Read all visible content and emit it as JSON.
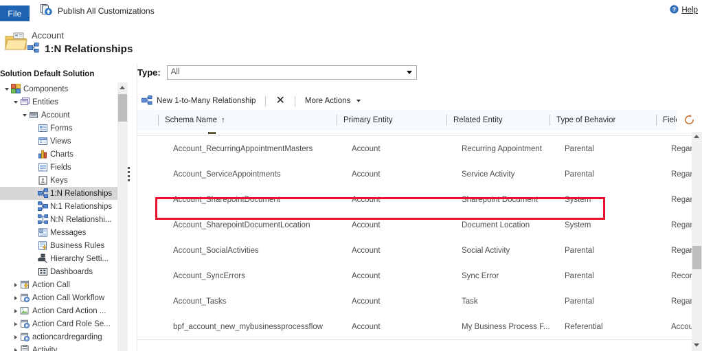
{
  "ribbon": {
    "file_tab": "File",
    "publish_label": "Publish All Customizations",
    "publish_icon": "publish-icon",
    "help_label": "Help",
    "help_icon": "help-icon"
  },
  "page_header": {
    "entity_name": "Account",
    "title": "1:N Relationships",
    "folder_icon": "folder-icon",
    "relationship_icon": "one-to-many-icon"
  },
  "solution": {
    "label": "Solution Default Solution"
  },
  "tree": {
    "items": [
      {
        "label": "Components",
        "depth": 0,
        "twisty": "open",
        "icon": "components-icon",
        "selected": false
      },
      {
        "label": "Entities",
        "depth": 1,
        "twisty": "open",
        "icon": "entities-icon",
        "selected": false
      },
      {
        "label": "Account",
        "depth": 2,
        "twisty": "open",
        "icon": "entity-icon",
        "selected": false
      },
      {
        "label": "Forms",
        "depth": 3,
        "twisty": "none",
        "icon": "forms-icon",
        "selected": false
      },
      {
        "label": "Views",
        "depth": 3,
        "twisty": "none",
        "icon": "views-icon",
        "selected": false
      },
      {
        "label": "Charts",
        "depth": 3,
        "twisty": "none",
        "icon": "charts-icon",
        "selected": false
      },
      {
        "label": "Fields",
        "depth": 3,
        "twisty": "none",
        "icon": "fields-icon",
        "selected": false
      },
      {
        "label": "Keys",
        "depth": 3,
        "twisty": "none",
        "icon": "keys-icon",
        "selected": false
      },
      {
        "label": "1:N Relationships",
        "depth": 3,
        "twisty": "none",
        "icon": "one-to-many-icon",
        "selected": true
      },
      {
        "label": "N:1 Relationships",
        "depth": 3,
        "twisty": "none",
        "icon": "many-to-one-icon",
        "selected": false
      },
      {
        "label": "N:N Relationshi...",
        "depth": 3,
        "twisty": "none",
        "icon": "many-to-many-icon",
        "selected": false
      },
      {
        "label": "Messages",
        "depth": 3,
        "twisty": "none",
        "icon": "messages-icon",
        "selected": false
      },
      {
        "label": "Business Rules",
        "depth": 3,
        "twisty": "none",
        "icon": "business-rules-icon",
        "selected": false
      },
      {
        "label": "Hierarchy Setti...",
        "depth": 3,
        "twisty": "none",
        "icon": "hierarchy-icon",
        "selected": false
      },
      {
        "label": "Dashboards",
        "depth": 3,
        "twisty": "none",
        "icon": "dashboards-icon",
        "selected": false
      },
      {
        "label": "Action Call",
        "depth": 1,
        "twisty": "closed",
        "icon": "action-call-icon",
        "selected": false
      },
      {
        "label": "Action Call Workflow",
        "depth": 1,
        "twisty": "closed",
        "icon": "entity-gear-icon",
        "selected": false
      },
      {
        "label": "Action Card Action ...",
        "depth": 1,
        "twisty": "closed",
        "icon": "action-card-icon",
        "selected": false
      },
      {
        "label": "Action Card Role Se...",
        "depth": 1,
        "twisty": "closed",
        "icon": "entity-gear-icon",
        "selected": false
      },
      {
        "label": "actioncardregarding",
        "depth": 1,
        "twisty": "closed",
        "icon": "entity-gear-icon",
        "selected": false
      },
      {
        "label": "Activity",
        "depth": 1,
        "twisty": "closed",
        "icon": "activity-icon",
        "selected": false
      }
    ]
  },
  "filter": {
    "type_label": "Type:",
    "type_value": "All",
    "type_placeholder": "All"
  },
  "grid_toolbar": {
    "new_relationship_label": "New 1-to-Many Relationship",
    "new_relationship_icon": "one-to-many-icon",
    "delete_icon": "close-x-icon",
    "more_actions_label": "More Actions"
  },
  "grid": {
    "columns": [
      {
        "label": "Schema Name",
        "sort": "↑"
      },
      {
        "label": "Primary Entity",
        "sort": ""
      },
      {
        "label": "Related Entity",
        "sort": ""
      },
      {
        "label": "Type of Behavior",
        "sort": ""
      },
      {
        "label": "Field",
        "sort": ""
      }
    ],
    "rows": [
      {
        "schema_name": "Account_RecurringAppointmentMasters",
        "primary_entity": "Account",
        "related_entity": "Recurring Appointment",
        "behavior": "Parental",
        "field": "Regard",
        "highlighted": false
      },
      {
        "schema_name": "Account_ServiceAppointments",
        "primary_entity": "Account",
        "related_entity": "Service Activity",
        "behavior": "Parental",
        "field": "Regard",
        "highlighted": false
      },
      {
        "schema_name": "Account_SharepointDocument",
        "primary_entity": "Account",
        "related_entity": "Sharepoint Document",
        "behavior": "System",
        "field": "Regard",
        "highlighted": true
      },
      {
        "schema_name": "Account_SharepointDocumentLocation",
        "primary_entity": "Account",
        "related_entity": "Document Location",
        "behavior": "System",
        "field": "Regard",
        "highlighted": false
      },
      {
        "schema_name": "Account_SocialActivities",
        "primary_entity": "Account",
        "related_entity": "Social Activity",
        "behavior": "Parental",
        "field": "Regard",
        "highlighted": false
      },
      {
        "schema_name": "Account_SyncErrors",
        "primary_entity": "Account",
        "related_entity": "Sync Error",
        "behavior": "Parental",
        "field": "Record",
        "highlighted": false
      },
      {
        "schema_name": "Account_Tasks",
        "primary_entity": "Account",
        "related_entity": "Task",
        "behavior": "Parental",
        "field": "Regard",
        "highlighted": false
      },
      {
        "schema_name": "bpf_account_new_mybusinessprocessflow",
        "primary_entity": "Account",
        "related_entity": "My Business Process F...",
        "behavior": "Referential",
        "field": "Accoun",
        "highlighted": false
      }
    ]
  },
  "status": {
    "loading_icon": "refresh-spinner-icon"
  },
  "colors": {
    "accent": "#1f63b3",
    "highlight": "#e8112d",
    "header_bg": "#f7fafd",
    "selection": "#d6d6d6"
  }
}
